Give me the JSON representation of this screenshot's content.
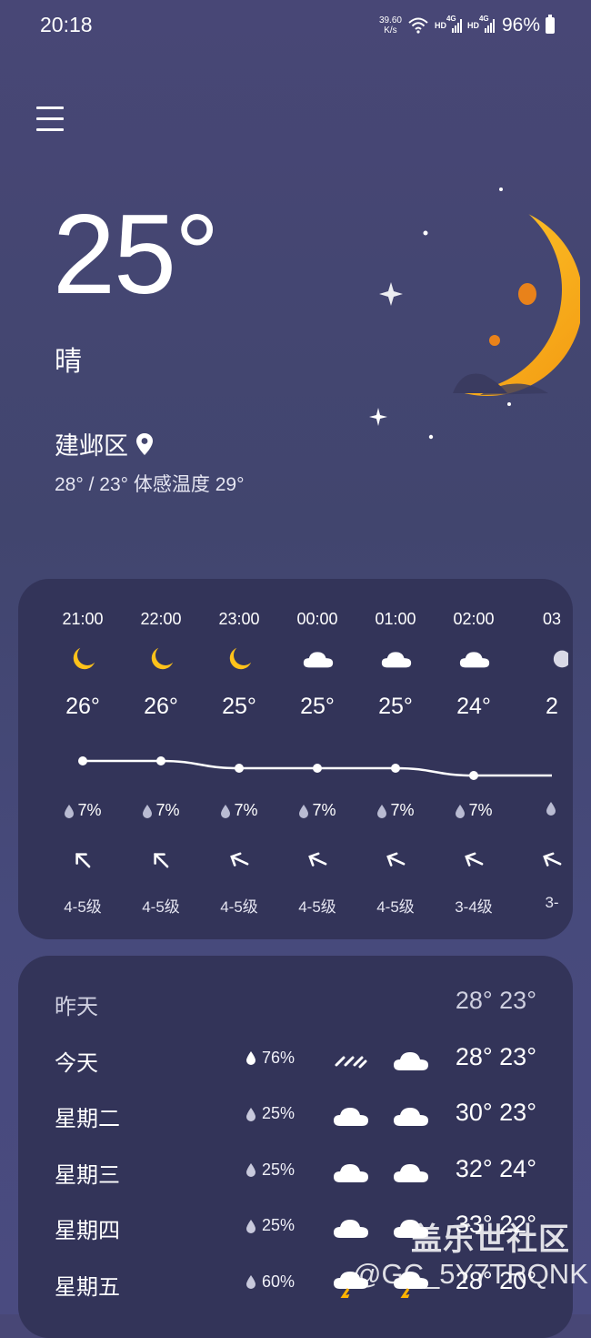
{
  "status_bar": {
    "time": "20:18",
    "net_speed_value": "39.60",
    "net_speed_unit": "K/s",
    "hd1": "HD",
    "hd2": "HD",
    "sig1": "4G",
    "sig2": "4G",
    "battery": "96%"
  },
  "current": {
    "temperature": "25°",
    "condition": "晴",
    "location": "建邺区",
    "temp_range": "28° / 23°",
    "feels_like": "体感温度 29°"
  },
  "hourly": [
    {
      "time": "21:00",
      "icon": "crescent-moon-icon",
      "temp": "26°",
      "rain": "7%",
      "wind": "4-5级",
      "wind_dir_deg": -45,
      "curve_value": 26
    },
    {
      "time": "22:00",
      "icon": "crescent-moon-icon",
      "temp": "26°",
      "rain": "7%",
      "wind": "4-5级",
      "wind_dir_deg": -45,
      "curve_value": 26
    },
    {
      "time": "23:00",
      "icon": "crescent-moon-icon",
      "temp": "25°",
      "rain": "7%",
      "wind": "4-5级",
      "wind_dir_deg": -65,
      "curve_value": 25
    },
    {
      "time": "00:00",
      "icon": "cloud-icon",
      "temp": "25°",
      "rain": "7%",
      "wind": "4-5级",
      "wind_dir_deg": -65,
      "curve_value": 25
    },
    {
      "time": "01:00",
      "icon": "cloud-icon",
      "temp": "25°",
      "rain": "7%",
      "wind": "4-5级",
      "wind_dir_deg": -65,
      "curve_value": 25
    },
    {
      "time": "02:00",
      "icon": "cloud-icon",
      "temp": "24°",
      "rain": "7%",
      "wind": "3-4级",
      "wind_dir_deg": -65,
      "curve_value": 24
    },
    {
      "time": "03",
      "icon": "partial-icon",
      "temp": "2",
      "rain": "",
      "wind": "3-",
      "wind_dir_deg": -65,
      "curve_value": 24
    }
  ],
  "daily": [
    {
      "day": "昨天",
      "rain": "",
      "icon1": "",
      "icon2": "",
      "temps": "28° 23°",
      "muted": true
    },
    {
      "day": "今天",
      "rain": "76%",
      "icon1": "rain-streak-icon",
      "icon2": "cloud-icon",
      "temps": "28° 23°"
    },
    {
      "day": "星期二",
      "rain": "25%",
      "icon1": "cloud-icon",
      "icon2": "cloud-icon",
      "temps": "30° 23°"
    },
    {
      "day": "星期三",
      "rain": "25%",
      "icon1": "cloud-icon",
      "icon2": "cloud-icon",
      "temps": "32° 24°"
    },
    {
      "day": "星期四",
      "rain": "25%",
      "icon1": "cloud-icon",
      "icon2": "cloud-icon",
      "temps": "33° 22°"
    },
    {
      "day": "星期五",
      "rain": "60%",
      "icon1": "thunder-cloud-icon",
      "icon2": "thunder-cloud-icon",
      "temps": "28° 20°"
    }
  ],
  "watermark": {
    "title": "盖乐世社区",
    "user": "@GC_5Y7TRQNK"
  },
  "colors": {
    "background": "#44466f",
    "card": "#333459",
    "moon": "#f7b21a"
  }
}
